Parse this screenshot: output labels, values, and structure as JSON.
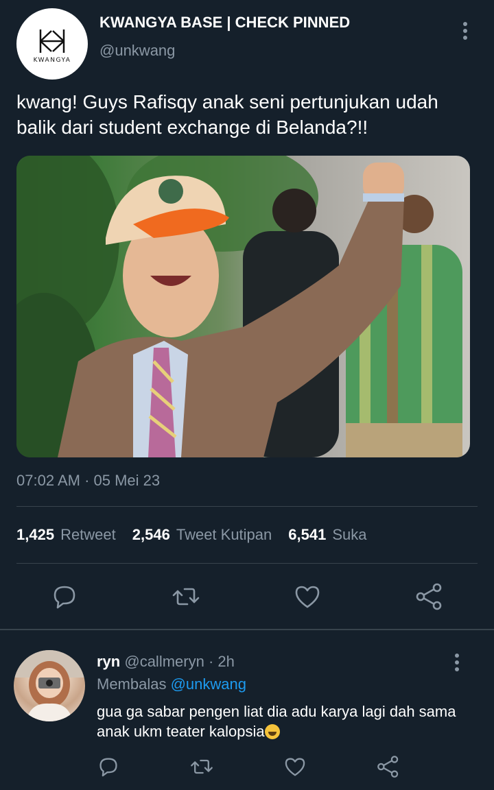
{
  "tweet": {
    "author": {
      "display_name": "KWANGYA BASE | CHECK PINNED",
      "handle": "@unkwang",
      "avatar_wordmark": "KWANGYA"
    },
    "text": "kwang! Guys Rafisqy anak seni pertunjukan udah balik dari student exchange di Belanda?!!",
    "timestamp": "07:02 AM · 05 Mei 23",
    "stats": {
      "retweet_count": "1,425",
      "retweet_label": "Retweet",
      "quote_count": "2,546",
      "quote_label": "Tweet Kutipan",
      "like_count": "6,541",
      "like_label": "Suka"
    },
    "actions": [
      "reply-icon",
      "retweet-icon",
      "like-icon",
      "share-icon"
    ]
  },
  "reply": {
    "name": "ryn",
    "meta": " @callmeryn · 2h",
    "replying_prefix": "Membalas ",
    "replying_to": "@unkwang",
    "text": "gua ga sabar pengen liat dia adu karya lagi dah sama anak ukm teater kalopsia",
    "emoji": "rolling-on-floor-laughing"
  },
  "colors": {
    "background": "#15202b",
    "secondary_text": "#8b98a5",
    "divider": "#38444d",
    "link": "#1d9bf0"
  }
}
